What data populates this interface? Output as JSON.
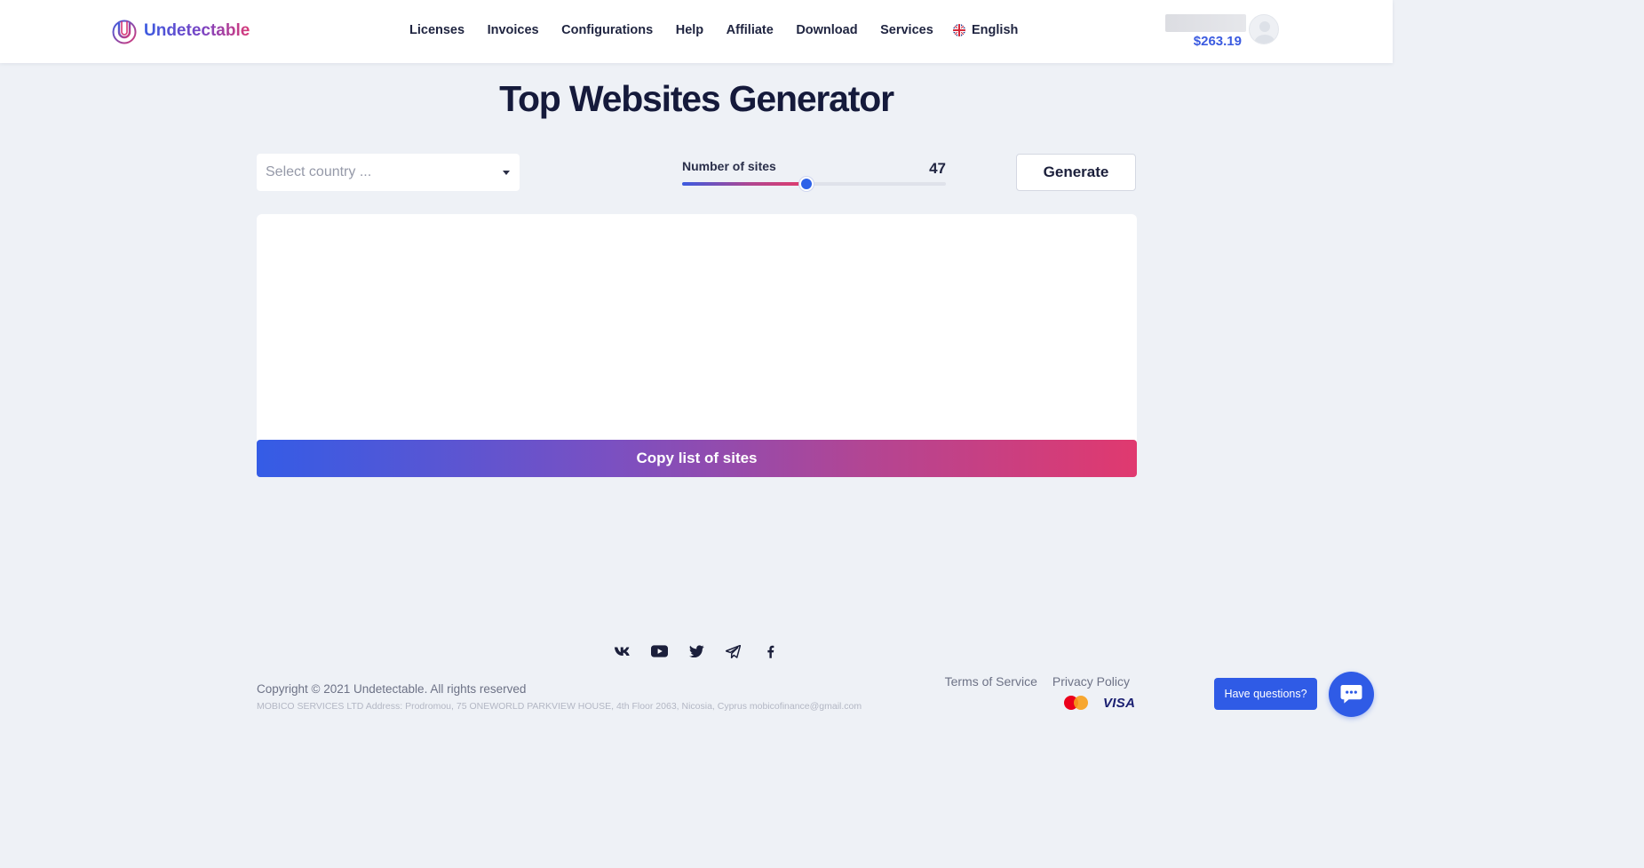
{
  "header": {
    "brand": "Undetectable",
    "nav": [
      {
        "label": "Licenses"
      },
      {
        "label": "Invoices"
      },
      {
        "label": "Configurations"
      },
      {
        "label": "Help"
      },
      {
        "label": "Affiliate"
      },
      {
        "label": "Download"
      },
      {
        "label": "Services"
      }
    ],
    "language": "English",
    "language_icon": "uk-flag-icon",
    "balance": "$263.19",
    "avatar_icon": "user-avatar-icon"
  },
  "main": {
    "title": "Top Websites Generator",
    "country_select": {
      "placeholder": "Select country ...",
      "icon": "caret-down-icon"
    },
    "slider": {
      "label": "Number of sites",
      "value": "47",
      "fill_percent": 47
    },
    "generate_label": "Generate",
    "sites_list": "",
    "copy_label": "Copy list of sites"
  },
  "footer": {
    "socials": [
      "vk-icon",
      "youtube-icon",
      "twitter-icon",
      "telegram-icon",
      "facebook-icon"
    ],
    "copyright": "Copyright © 2021 Undetectable. All rights reserved",
    "address": "MOBICO SERVICES LTD Address: Prodromou, 75 ONEWORLD PARKVIEW HOUSE, 4th Floor 2063, Nicosia, Cyprus mobicofinance@gmail.com",
    "links": {
      "terms": "Terms of Service",
      "privacy": "Privacy Policy"
    },
    "payments": {
      "mastercard_icon": "mastercard-icon",
      "visa": "VISA"
    }
  },
  "chat": {
    "tooltip": "Have questions?",
    "icon": "chat-bubble-icon"
  },
  "colors": {
    "accent": "#2f5be6",
    "gradient_start": "#345ce6",
    "gradient_end": "#e0396f",
    "background": "#eef1f6"
  }
}
